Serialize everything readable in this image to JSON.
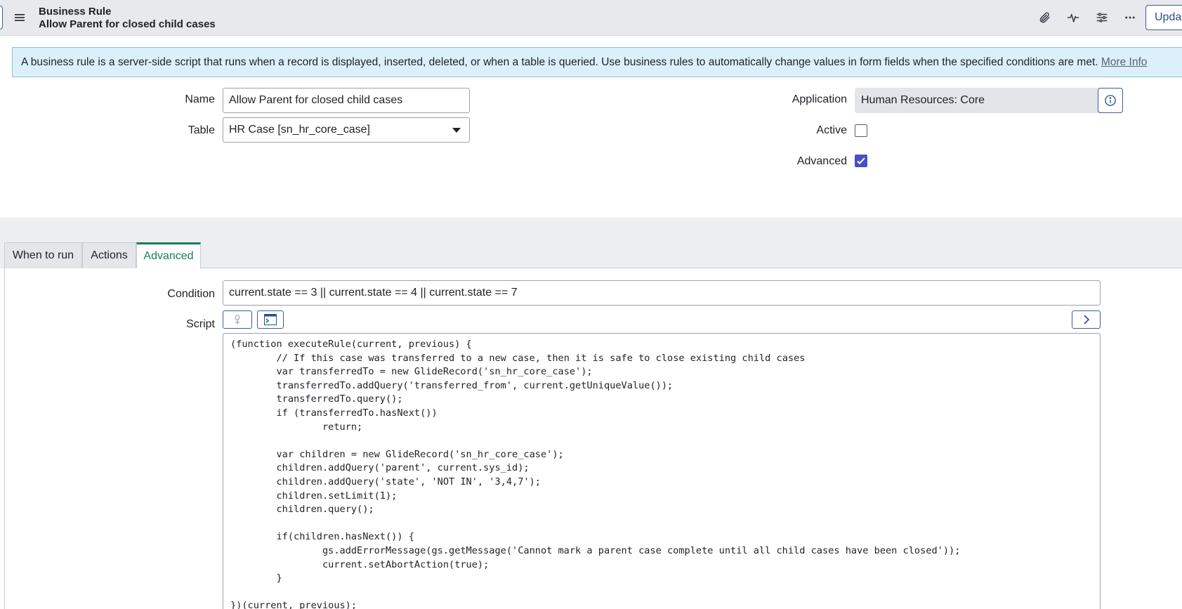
{
  "header": {
    "record_type": "Business Rule",
    "record_name": "Allow Parent for closed child cases",
    "update_label": "Upda",
    "icons": [
      "paperclip-icon",
      "activity-icon",
      "sliders-icon",
      "more-icon"
    ]
  },
  "banner": {
    "text": "A business rule is a server-side script that runs when a record is displayed, inserted, deleted, or when a table is queried. Use business rules to automatically change values in form fields when the specified conditions are met. ",
    "link": "More Info"
  },
  "form": {
    "name_label": "Name",
    "name_value": "Allow Parent for closed child cases",
    "table_label": "Table",
    "table_value": "HR Case [sn_hr_core_case]",
    "application_label": "Application",
    "application_value": "Human Resources: Core",
    "active_label": "Active",
    "active_checked": false,
    "advanced_label": "Advanced",
    "advanced_checked": true
  },
  "tabs": [
    {
      "label": "When to run",
      "active": false
    },
    {
      "label": "Actions",
      "active": false
    },
    {
      "label": "Advanced",
      "active": true
    }
  ],
  "advanced": {
    "condition_label": "Condition",
    "condition_value": "current.state == 3 || current.state == 4 || current.state == 7",
    "script_label": "Script",
    "script_code": "(function executeRule(current, previous) {\n\t// If this case was transferred to a new case, then it is safe to close existing child cases\n\tvar transferredTo = new GlideRecord('sn_hr_core_case');\n\ttransferredTo.addQuery('transferred_from', current.getUniqueValue());\n\ttransferredTo.query();\n\tif (transferredTo.hasNext())\n\t\treturn;\n\n\tvar children = new GlideRecord('sn_hr_core_case');\n\tchildren.addQuery('parent', current.sys_id);\n\tchildren.addQuery('state', 'NOT IN', '3,4,7');\n\tchildren.setLimit(1);\n\tchildren.query();\n\n\tif(children.hasNext()) {\n\t\tgs.addErrorMessage(gs.getMessage('Cannot mark a parent case complete until all child cases have been closed'));\n\t\tcurrent.setAbortAction(true);\n\t}\n\n})(current, previous);"
  },
  "colors": {
    "accent": "#1a7c5a",
    "button_border": "#3c5d9a",
    "checkbox_checked": "#4a4fc4",
    "banner_bg": "#dcf0fb"
  }
}
